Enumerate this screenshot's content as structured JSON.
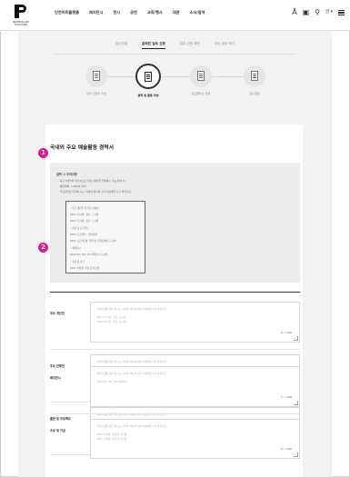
{
  "brand": {
    "line1": "INCHEON ART",
    "line2": "PLATFORM"
  },
  "nav": {
    "items": [
      "인천아트플랫폼",
      "레지던시",
      "전시",
      "공연",
      "교육/행사",
      "대관",
      "소식/참여"
    ],
    "lang": "한 ▾"
  },
  "tabs": [
    "입주안내",
    "온라인 입주 신청",
    "입주 신청 확인",
    "지난 공모 보기"
  ],
  "steps": [
    "입주 신청서 작성",
    "경력 및 활동 작성",
    "포트폴리오 첨부",
    "접수완료"
  ],
  "heading": "국내외 주요 예술활동 경력서",
  "guide": {
    "title": "입력 시 주의사항",
    "notes": [
      "· 최근 5년부터 최신순으로 작성 (분야별 전체복수 가능 최대 5)",
      "· 예문제목: 1,000자 이내",
      "· 주요경력을 입력하시고, 아래의 예시와 같이 작성해주시기 바랍니다."
    ],
    "example": [
      "– 주요 개인전 및 주요 단체전",
      "  2023 '전시명', 장소, 도시명",
      "  2022 '전시명', 장소, 도시명",
      "– 출판 및 프로젝트",
      "  2023 '프로젝트', 출판사명",
      "  2021 프로젝트명, 협업 및 후원단체명, 도시명",
      "– 레지던시",
      "  2022 00 / 00 / 00 레지던시 도시명",
      "– 수상 및 기금",
      "  2021 수상명, 수상 및 기금명"
    ]
  },
  "fields": [
    {
      "label": "주요 개인전",
      "placeholder": "국외의 활동 등록 하시고, 아래의 예시와 같이 작성해주시기 바랍니다.",
      "ex1": "2023 '전시명', 장소, 도시명",
      "ex2": "2022 '전시명', 장소, 도시명",
      "count": "0 / 1,000"
    },
    {
      "label": "주요 단체전",
      "placeholder": "국외의 활동 등록 하시고, 아래의 예시와 같이 작성해주시기 바랍니다.",
      "ex1": "2023 '전시명', 장소, 도시명",
      "ex2": "2022 '전시명', 장소, 도시명",
      "count": "0 / 1,000"
    },
    {
      "label": "출판 및 프로젝트",
      "placeholder": "국외의 활동 등록 하시고, 아래의 예시와 같이 작성해주시기 바랍니다.",
      "ex1": "2023 '프로젝트', 출판사명",
      "ex2": "2021 프로젝트명, 협업 및 후원단체명, 도시명",
      "count": "0 / 1,000"
    },
    {
      "label": "레지던시",
      "placeholder": "국외의 활동 등록 하시고, 아래의 예시와 같이 작성해주시기 바랍니다.",
      "ex1": "2022 00 / 00 / 00 레지던시",
      "ex2": "",
      "count": "0 / 1,000"
    },
    {
      "label": "수상 및 기금",
      "placeholder": "국외의 활동 등록 하시고, 아래의 예시와 같이 작성해주시기 바랍니다.",
      "ex1": "2023 수상명, 수상 및 기금명",
      "ex2": "2021 수상명, 수상 및 기금명",
      "count": "0 / 1,000"
    }
  ],
  "badges": [
    "1",
    "2"
  ],
  "colors": {
    "badge": "#e6168c",
    "background": "#f2f2f2"
  }
}
